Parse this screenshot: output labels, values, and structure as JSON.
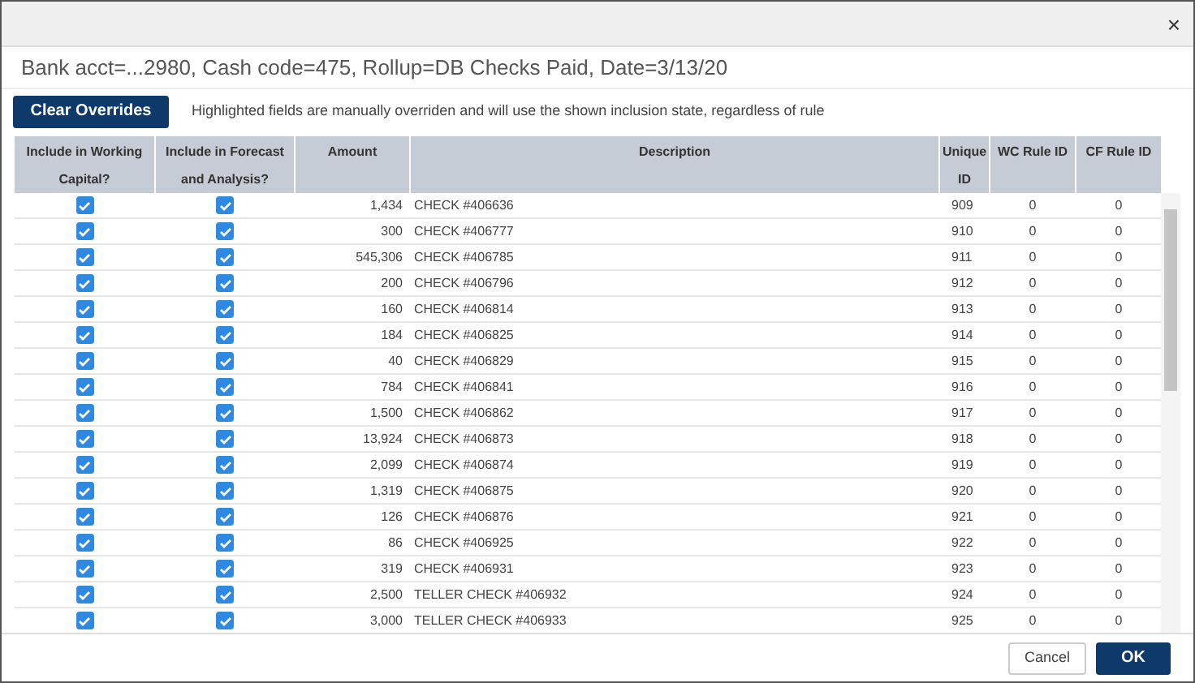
{
  "dialog": {
    "close_label": "×",
    "heading": "Bank acct=...2980, Cash code=475, Rollup=DB Checks Paid, Date=3/13/20"
  },
  "toolbar": {
    "button": "Clear Overrides",
    "note": "Highlighted fields are manually overriden and will use the shown inclusion state, regardless of rule"
  },
  "table": {
    "columns": [
      "Include in Working Capital?",
      "Include in Forecast and Analysis?",
      "Amount",
      "Description",
      "Unique ID",
      "WC Rule ID",
      "CF Rule ID"
    ],
    "rows": [
      {
        "wc": true,
        "cf": true,
        "amount": "1,434",
        "description": "CHECK #406636",
        "unique_id": "909",
        "wc_rule": "0",
        "cf_rule": "0"
      },
      {
        "wc": true,
        "cf": true,
        "amount": "300",
        "description": "CHECK #406777",
        "unique_id": "910",
        "wc_rule": "0",
        "cf_rule": "0"
      },
      {
        "wc": true,
        "cf": true,
        "amount": "545,306",
        "description": "CHECK #406785",
        "unique_id": "911",
        "wc_rule": "0",
        "cf_rule": "0"
      },
      {
        "wc": true,
        "cf": true,
        "amount": "200",
        "description": "CHECK #406796",
        "unique_id": "912",
        "wc_rule": "0",
        "cf_rule": "0"
      },
      {
        "wc": true,
        "cf": true,
        "amount": "160",
        "description": "CHECK #406814",
        "unique_id": "913",
        "wc_rule": "0",
        "cf_rule": "0"
      },
      {
        "wc": true,
        "cf": true,
        "amount": "184",
        "description": "CHECK #406825",
        "unique_id": "914",
        "wc_rule": "0",
        "cf_rule": "0"
      },
      {
        "wc": true,
        "cf": true,
        "amount": "40",
        "description": "CHECK #406829",
        "unique_id": "915",
        "wc_rule": "0",
        "cf_rule": "0"
      },
      {
        "wc": true,
        "cf": true,
        "amount": "784",
        "description": "CHECK #406841",
        "unique_id": "916",
        "wc_rule": "0",
        "cf_rule": "0"
      },
      {
        "wc": true,
        "cf": true,
        "amount": "1,500",
        "description": "CHECK #406862",
        "unique_id": "917",
        "wc_rule": "0",
        "cf_rule": "0"
      },
      {
        "wc": true,
        "cf": true,
        "amount": "13,924",
        "description": "CHECK #406873",
        "unique_id": "918",
        "wc_rule": "0",
        "cf_rule": "0"
      },
      {
        "wc": true,
        "cf": true,
        "amount": "2,099",
        "description": "CHECK #406874",
        "unique_id": "919",
        "wc_rule": "0",
        "cf_rule": "0"
      },
      {
        "wc": true,
        "cf": true,
        "amount": "1,319",
        "description": "CHECK #406875",
        "unique_id": "920",
        "wc_rule": "0",
        "cf_rule": "0"
      },
      {
        "wc": true,
        "cf": true,
        "amount": "126",
        "description": "CHECK #406876",
        "unique_id": "921",
        "wc_rule": "0",
        "cf_rule": "0"
      },
      {
        "wc": true,
        "cf": true,
        "amount": "86",
        "description": "CHECK #406925",
        "unique_id": "922",
        "wc_rule": "0",
        "cf_rule": "0"
      },
      {
        "wc": true,
        "cf": true,
        "amount": "319",
        "description": "CHECK #406931",
        "unique_id": "923",
        "wc_rule": "0",
        "cf_rule": "0"
      },
      {
        "wc": true,
        "cf": true,
        "amount": "2,500",
        "description": "TELLER CHECK #406932",
        "unique_id": "924",
        "wc_rule": "0",
        "cf_rule": "0"
      },
      {
        "wc": true,
        "cf": true,
        "amount": "3,000",
        "description": "TELLER CHECK #406933",
        "unique_id": "925",
        "wc_rule": "0",
        "cf_rule": "0"
      }
    ]
  },
  "footer": {
    "cancel": "Cancel",
    "ok": "OK"
  }
}
